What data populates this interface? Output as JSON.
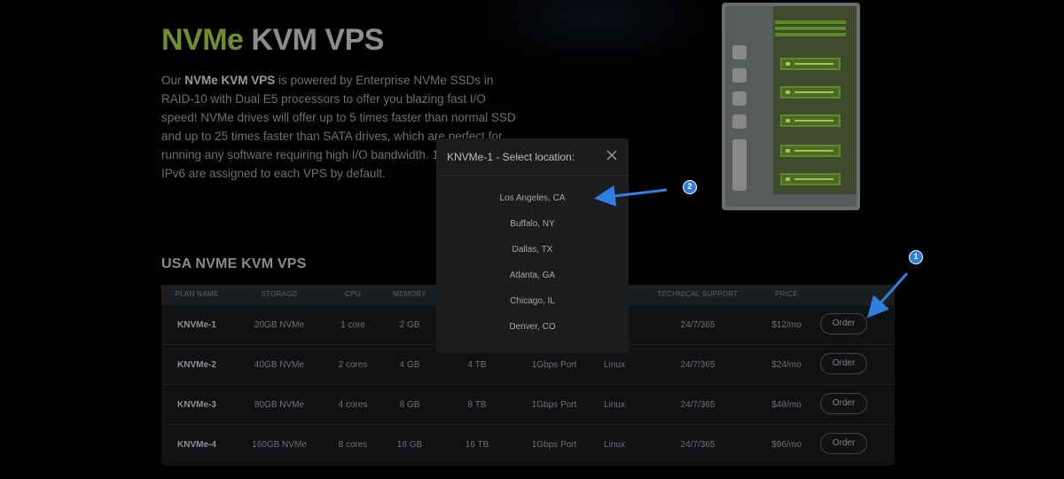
{
  "hero": {
    "title_accent": "NVMe",
    "title_rest": "KVM VPS",
    "intro_prefix": "Our ",
    "intro_bold": "NVMe KVM VPS",
    "intro_text": " is powered by Enterprise NVMe SSDs in RAID-10 with Dual E5 processors to offer you blazing fast I/O speed! NVMe drives will offer up to 5 times faster than normal SSD and up to 25 times faster than SATA drives, which are perfect for running any software requiring high I/O bandwidth. 1 IPv4 and /112 IPv6 are assigned to each VPS by default."
  },
  "section": {
    "title": "USA NVME KVM VPS"
  },
  "table": {
    "headers": {
      "plan": "PLAN NAME",
      "storage": "STORAGE",
      "cpu": "CPU",
      "memory": "MEMORY",
      "support": "TECHNICAL SUPPORT",
      "price": "PRICE"
    },
    "rows": [
      {
        "plan": "KNVMe-1",
        "storage": "20GB NVMe",
        "cpu": "1 core",
        "memory": "2 GB",
        "bandwidth": "",
        "port": "",
        "os": "",
        "support": "24/7/365",
        "price": "$12/mo",
        "order": "Order"
      },
      {
        "plan": "KNVMe-2",
        "storage": "40GB NVMe",
        "cpu": "2 cores",
        "memory": "4 GB",
        "bandwidth": "4 TB",
        "port": "1Gbps Port",
        "os": "Linux",
        "support": "24/7/365",
        "price": "$24/mo",
        "order": "Order"
      },
      {
        "plan": "KNVMe-3",
        "storage": "80GB NVMe",
        "cpu": "4 cores",
        "memory": "8 GB",
        "bandwidth": "8 TB",
        "port": "1Gbps Port",
        "os": "Linux",
        "support": "24/7/365",
        "price": "$48/mo",
        "order": "Order"
      },
      {
        "plan": "KNVMe-4",
        "storage": "160GB NVMe",
        "cpu": "8 cores",
        "memory": "16 GB",
        "bandwidth": "16 TB",
        "port": "1Gbps Port",
        "os": "Linux",
        "support": "24/7/365",
        "price": "$96/mo",
        "order": "Order"
      }
    ]
  },
  "modal": {
    "title": "KNVMe-1 - Select location:",
    "locations": [
      "Los Angeles, CA",
      "Buffalo, NY",
      "Dallas, TX",
      "Atlanta, GA",
      "Chicago, IL",
      "Denver, CO"
    ]
  },
  "annotations": {
    "badge1": "1",
    "badge2": "2"
  },
  "colors": {
    "accent_green": "#6f8f2f",
    "annotation_blue": "#2f7fe0"
  }
}
